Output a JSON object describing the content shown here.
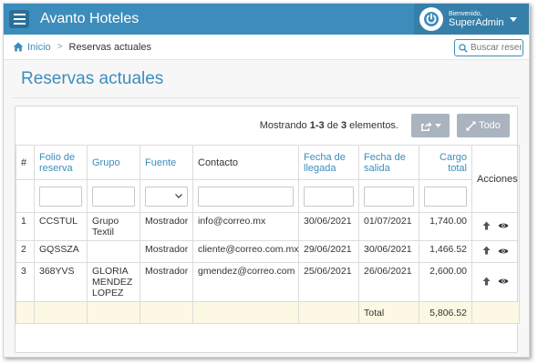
{
  "header": {
    "app_title": "Avanto Hoteles",
    "welcome": "Bienvenido,",
    "user_name": "SuperAdmin"
  },
  "breadcrumb": {
    "home": "Inicio",
    "current": "Reservas actuales"
  },
  "search": {
    "placeholder": "Buscar reser"
  },
  "page": {
    "title": "Reservas actuales"
  },
  "toolbar": {
    "count_prefix": "Mostrando ",
    "count_range": "1-3",
    "count_mid": " de ",
    "count_total": "3",
    "count_suffix": " elementos.",
    "all_label": "Todo"
  },
  "table": {
    "columns": {
      "index": "#",
      "folio": "Folio de reserva",
      "group": "Grupo",
      "source": "Fuente",
      "contact": "Contacto",
      "arrival": "Fecha de llegada",
      "departure": "Fecha de salida",
      "charge": "Cargo total",
      "actions": "Acciones"
    },
    "rows": [
      {
        "index": "1",
        "folio": "CCSTUL",
        "group": "Grupo Textil",
        "source": "Mostrador",
        "contact": "info@correo.mx",
        "arrival": "30/06/2021",
        "departure": "01/07/2021",
        "charge": "1,740.00"
      },
      {
        "index": "2",
        "folio": "GQSSZA",
        "group": "",
        "source": "Mostrador",
        "contact": "cliente@correo.com.mx",
        "arrival": "29/06/2021",
        "departure": "30/06/2021",
        "charge": "1,466.52"
      },
      {
        "index": "3",
        "folio": "368YVS",
        "group": "GLORIA MENDEZ LOPEZ",
        "source": "Mostrador",
        "contact": "gmendez@correo.com",
        "arrival": "25/06/2021",
        "departure": "26/06/2021",
        "charge": "2,600.00"
      }
    ],
    "total_label": "Total",
    "total_value": "5,806.52"
  },
  "colors": {
    "primary": "#3c8dbc",
    "header_user_bg": "#367fa9",
    "button_disabled": "#a9b4be",
    "total_row_bg": "#fcf8e3"
  },
  "icons": [
    "menu-icon",
    "power-icon",
    "caret-down-icon",
    "home-icon",
    "search-icon",
    "share-icon",
    "expand-icon",
    "chevron-down-icon",
    "arrow-up-icon",
    "eye-icon"
  ]
}
